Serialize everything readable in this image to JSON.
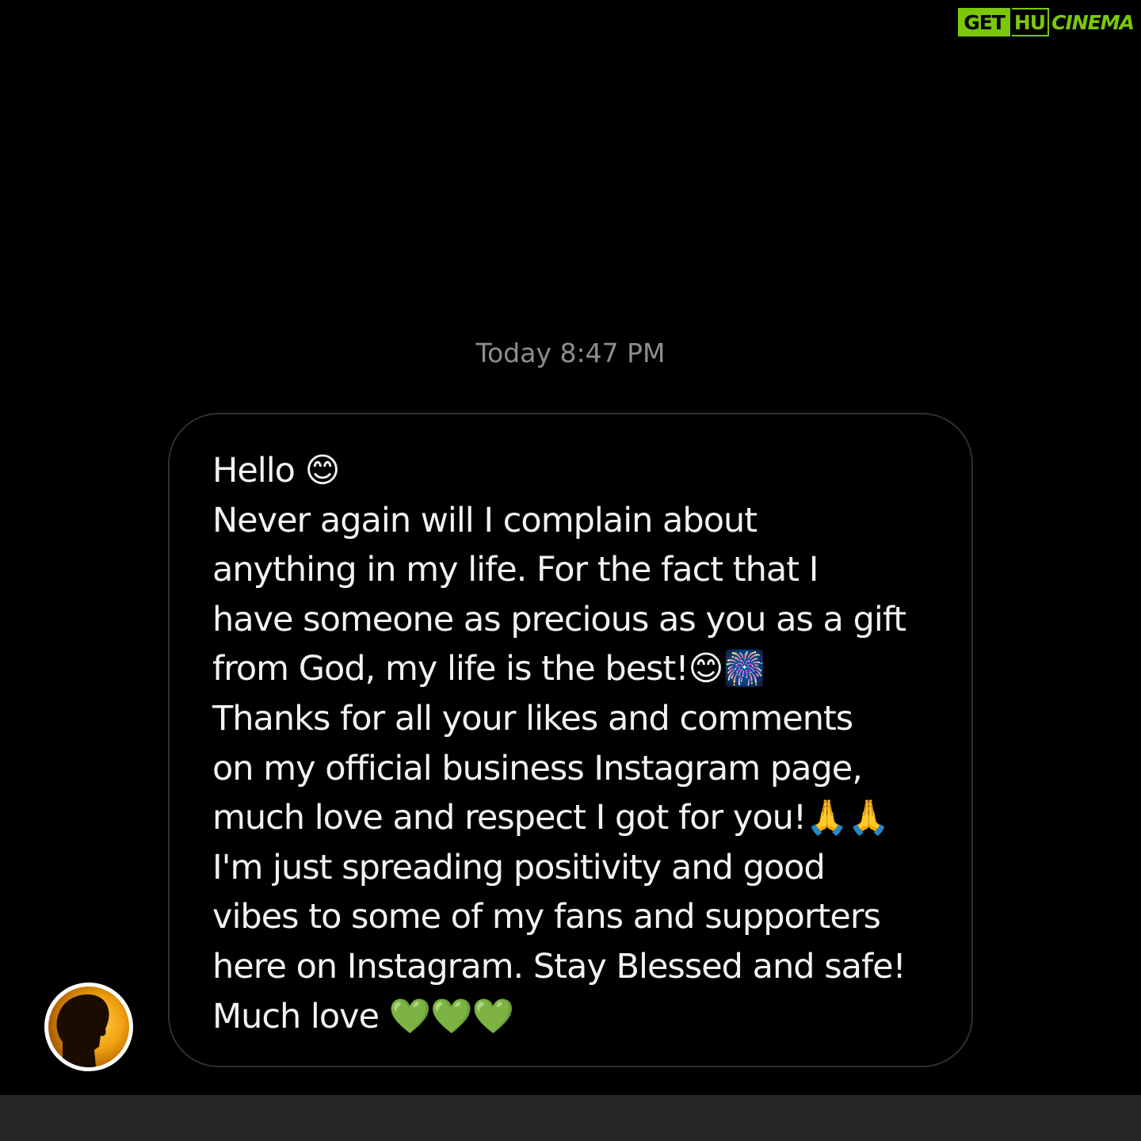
{
  "watermark": {
    "part1": "GET",
    "part2": "HU",
    "part3": "CINEMA"
  },
  "thread": {
    "timestamp": "Today 8:47 PM",
    "message": {
      "lines": [
        "Hello 😊",
        "Never again will I complain about",
        "anything in my life. For the fact that I",
        "have someone as precious as you as a gift",
        "from God, my life is the best!😊🎆",
        "Thanks for all your likes and comments",
        "on my official business Instagram page,",
        "much love and respect I got for you!🙏🙏",
        "I'm just spreading positivity and good",
        "vibes to some of my fans and supporters",
        "here on Instagram. Stay Blessed and safe!",
        "Much love 💚💚💚"
      ]
    }
  },
  "colors": {
    "background": "#000000",
    "bubble_border": "#2f2f2f",
    "text": "#f2f2f2",
    "timestamp": "#8e8e8e",
    "watermark_green": "#7ac70c",
    "bottom_bar": "#262626"
  }
}
